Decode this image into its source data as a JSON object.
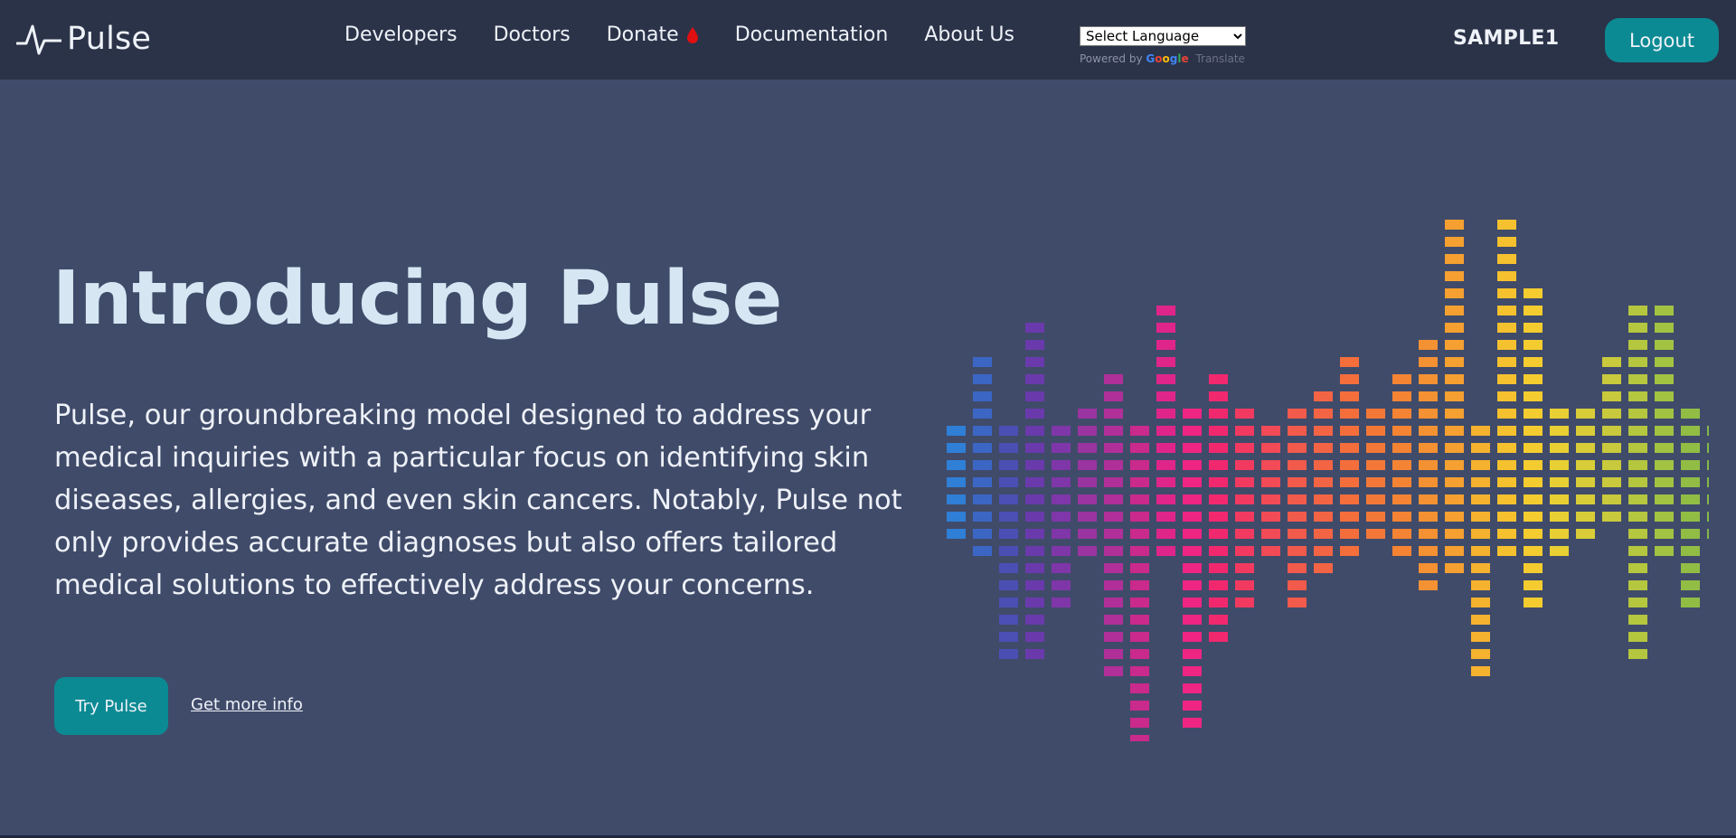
{
  "app": {
    "brand": "Pulse",
    "brand_icon": "heartbeat-icon"
  },
  "nav": {
    "items": [
      {
        "label": "Developers"
      },
      {
        "label": "Doctors"
      },
      {
        "label": "Donate",
        "icon": "blood-drop-icon",
        "icon_color": "#e01010"
      },
      {
        "label": "Documentation"
      },
      {
        "label": "About Us"
      }
    ],
    "language": {
      "selected": "Select Language",
      "powered_by": "Powered by",
      "google": "Google",
      "translate": "Translate"
    },
    "username": "SAMPLE1",
    "logout_label": "Logout"
  },
  "hero": {
    "title": "Introducing Pulse",
    "description": "Pulse, our groundbreaking model designed to address your medical inquiries with a particular focus on identifying skin diseases, allergies, and even skin cancers. Notably, Pulse not only provides accurate diagnoses but also offers tailored medical solutions to effectively address your concerns.",
    "primary_cta": "Try Pulse",
    "secondary_cta": "Get more info"
  },
  "colors": {
    "background": "#404b6a",
    "navbar": "#2b3349",
    "accent": "#0b8a93",
    "title": "#d6e7f3"
  },
  "equalizer": {
    "description_icon": "audio-equalizer-graphic",
    "columns": [
      {
        "up": 1,
        "down": 2,
        "color": "#2f7fd6"
      },
      {
        "up": 5,
        "down": 3,
        "color": "#3b66c4"
      },
      {
        "up": 1,
        "down": 9,
        "color": "#4b4fb4"
      },
      {
        "up": 7,
        "down": 9,
        "color": "#6a3aac"
      },
      {
        "up": 1,
        "down": 6,
        "color": "#7f36a8"
      },
      {
        "up": 2,
        "down": 3,
        "color": "#9a34a0"
      },
      {
        "up": 4,
        "down": 10,
        "color": "#b02f98"
      },
      {
        "up": 1,
        "down": 14,
        "color": "#c92a8c"
      },
      {
        "up": 8,
        "down": 3,
        "color": "#e0258a"
      },
      {
        "up": 2,
        "down": 13,
        "color": "#ee2582"
      },
      {
        "up": 4,
        "down": 8,
        "color": "#f2286f"
      },
      {
        "up": 2,
        "down": 6,
        "color": "#f23a60"
      },
      {
        "up": 1,
        "down": 3,
        "color": "#f24a56"
      },
      {
        "up": 2,
        "down": 6,
        "color": "#f25a4c"
      },
      {
        "up": 3,
        "down": 4,
        "color": "#f36445"
      },
      {
        "up": 5,
        "down": 3,
        "color": "#f46e3c"
      },
      {
        "up": 2,
        "down": 2,
        "color": "#f37838"
      },
      {
        "up": 4,
        "down": 3,
        "color": "#f48434"
      },
      {
        "up": 6,
        "down": 5,
        "color": "#f49132"
      },
      {
        "up": 13,
        "down": 4,
        "color": "#f5a030"
      },
      {
        "up": 1,
        "down": 10,
        "color": "#f5b22f"
      },
      {
        "up": 14,
        "down": 3,
        "color": "#f6c12e"
      },
      {
        "up": 9,
        "down": 6,
        "color": "#f4cc2f"
      },
      {
        "up": 2,
        "down": 3,
        "color": "#e8cf33"
      },
      {
        "up": 2,
        "down": 2,
        "color": "#d8cd38"
      },
      {
        "up": 5,
        "down": 1,
        "color": "#c8c93c"
      },
      {
        "up": 8,
        "down": 9,
        "color": "#b5c63f"
      },
      {
        "up": 8,
        "down": 3,
        "color": "#a2c242"
      },
      {
        "up": 2,
        "down": 6,
        "color": "#91bd45"
      },
      {
        "up": 1,
        "down": 2,
        "color": "#84b848"
      }
    ]
  }
}
